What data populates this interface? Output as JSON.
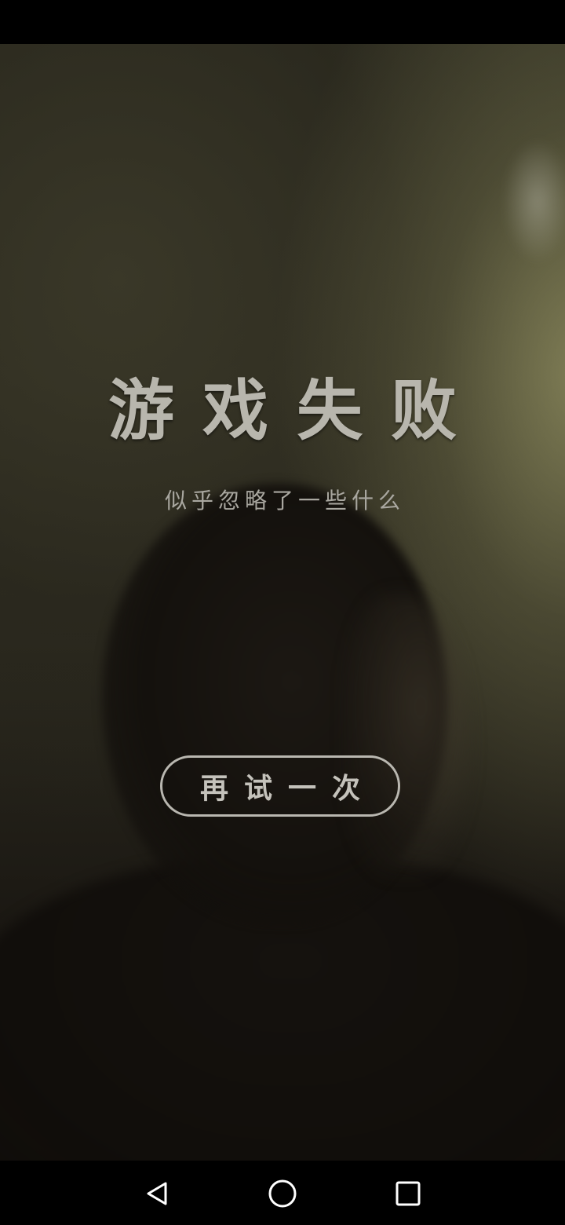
{
  "screen": {
    "title": "游戏失败",
    "subtitle": "似乎忽略了一些什么",
    "retry_label": "再试一次"
  },
  "nav": {
    "back_icon": "back-triangle-icon",
    "home_icon": "home-circle-icon",
    "recent_icon": "recent-apps-square-icon"
  },
  "colors": {
    "text": "#b8b6ad",
    "background_dark": "#120f0c",
    "ambient_light": "#96946a"
  }
}
